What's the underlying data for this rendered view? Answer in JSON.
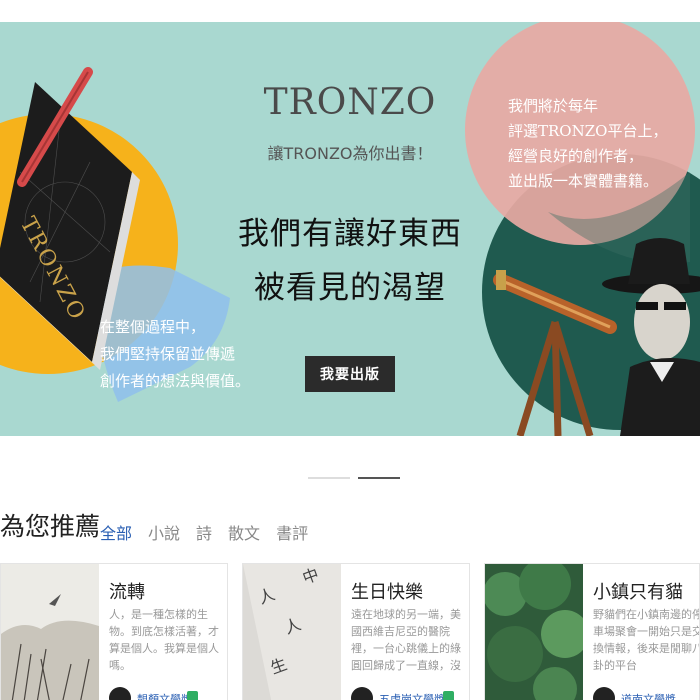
{
  "hero": {
    "brand": "TRONZO",
    "tagline": "讓TRONZO為你出書！",
    "headline_line1": "我們有讓好東西",
    "headline_line2": "被看見的渴望",
    "cta_label": "我要出版",
    "book_title": "TRONZO",
    "pink_text": [
      "我們將於每年",
      "評選TRONZO平台上，",
      "經營良好的創作者，",
      "並出版一本實體書籍。"
    ],
    "blue_text": [
      "在整個過程中，",
      "我們堅持保留並傳遞",
      "創作者的想法與價值。"
    ],
    "colors": {
      "bg": "#a9d8d0",
      "yellow": "#f6b21b",
      "pink": "#e8a9a3",
      "teal": "#1f5a4f",
      "blue": "#8fc0ec"
    }
  },
  "carousel": {
    "slides": 2,
    "active": 1
  },
  "recommend": {
    "title": "為您推薦",
    "filters": [
      {
        "label": "全部",
        "active": true
      },
      {
        "label": "小說",
        "active": false
      },
      {
        "label": "詩",
        "active": false
      },
      {
        "label": "散文",
        "active": false
      },
      {
        "label": "書評",
        "active": false
      }
    ]
  },
  "cards": [
    {
      "title": "流轉",
      "desc": "人，是一種怎樣的生物。到底怎樣活著，才算是個人。我算是個人嗎。",
      "author": "靚顏文學獎"
    },
    {
      "title": "生日快樂",
      "desc": "遠在地球的另一端，美國西維吉尼亞的醫院裡，一台心跳儀上的綠圓回歸成了一直線，沒有上揚的波瀾，也不",
      "author": "五虎崗文學獎"
    },
    {
      "title": "小鎮只有貓",
      "desc": "野貓們在小鎮南邊的停車場聚會一開始只是交換情報，後來是閒聊八卦的平台",
      "author": "道南文學獎"
    }
  ]
}
